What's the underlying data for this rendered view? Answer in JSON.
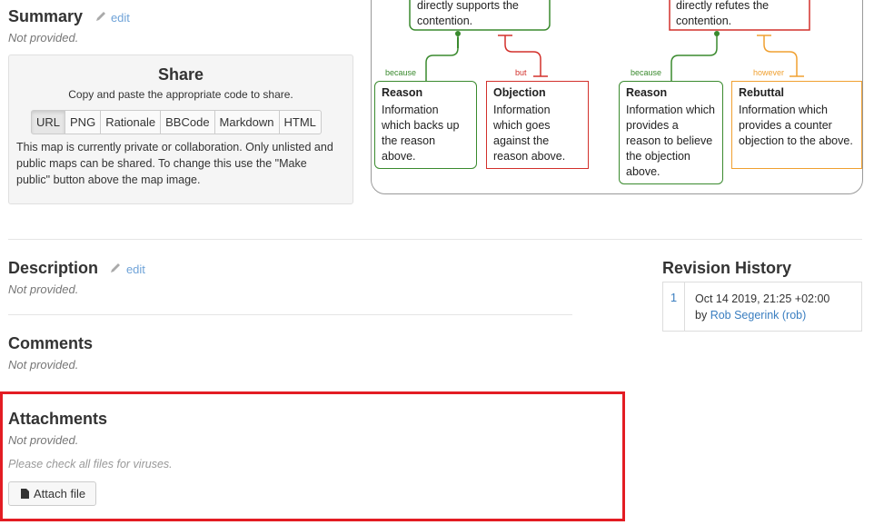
{
  "summary": {
    "title": "Summary",
    "edit_label": "edit",
    "value": "Not provided."
  },
  "share": {
    "title": "Share",
    "subtitle": "Copy and paste the appropriate code to share.",
    "tabs": [
      "URL",
      "PNG",
      "Rationale",
      "BBCode",
      "Markdown",
      "HTML"
    ],
    "active_tab": "URL",
    "note": "This map is currently private or collaboration. Only unlisted and public maps can be shared. To change this use the \"Make public\" button above the map image."
  },
  "map": {
    "top_left_text": "directly supports the contention.",
    "top_right_text": "directly  refutes the contention.",
    "nodes": [
      {
        "title": "Reason",
        "text": "Information which backs up the reason above.",
        "kind": "reason",
        "color": "#3a8a2e"
      },
      {
        "title": "Objection",
        "text": "Information which goes against the reason above.",
        "kind": "objection",
        "color": "#d2302b"
      },
      {
        "title": "Reason",
        "text": "Information which provides a reason to believe the objection above.",
        "kind": "reason",
        "color": "#3a8a2e"
      },
      {
        "title": "Rebuttal",
        "text": "Information which provides a counter objection to the above.",
        "kind": "rebuttal",
        "color": "#f0a030"
      }
    ],
    "connectors": {
      "because_1": "because",
      "but": "but",
      "because_2": "because",
      "however": "however"
    }
  },
  "description": {
    "title": "Description",
    "edit_label": "edit",
    "value": "Not provided."
  },
  "comments": {
    "title": "Comments",
    "value": "Not provided."
  },
  "attachments": {
    "title": "Attachments",
    "value": "Not provided.",
    "warning": "Please check all files for viruses.",
    "button_label": "Attach file",
    "highlight_color": "#e31c23"
  },
  "revision_history": {
    "title": "Revision History",
    "entries": [
      {
        "number": "1",
        "date": "Oct 14 2019, 21:25 +02:00",
        "by": "by",
        "author": "Rob Segerink (rob)"
      }
    ]
  },
  "colors": {
    "link": "#3a7ec0",
    "edit": "#6fa3d8",
    "reason": "#3a8a2e",
    "objection": "#d2302b",
    "rebuttal": "#f0a030"
  }
}
